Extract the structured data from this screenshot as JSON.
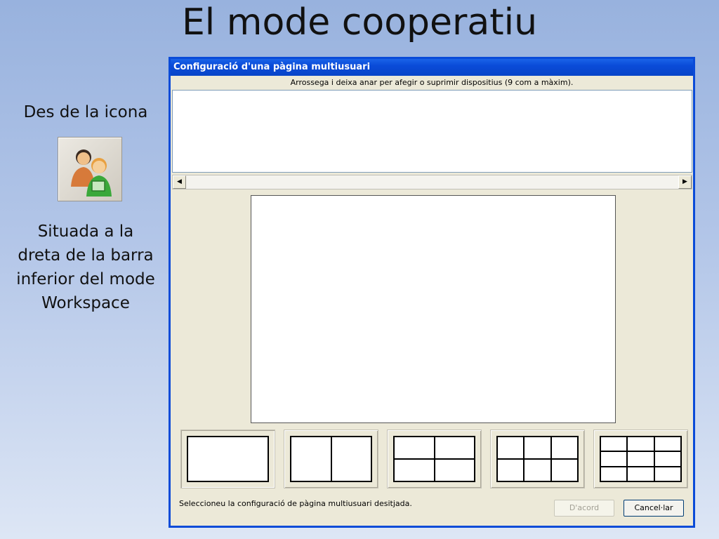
{
  "slide": {
    "title": "El mode cooperatiu",
    "caption_top": "Des de la icona",
    "caption_bottom": "Situada a la dreta de la barra inferior del mode Workspace"
  },
  "dialog": {
    "title": "Configuració d'una pàgina multiusuari",
    "instruction": "Arrossega i deixa anar per afegir o suprimir dispositius (9 com a màxim).",
    "status": "Seleccioneu la configuració de pàgina multiusuari desitjada.",
    "ok_label": "D'acord",
    "cancel_label": "Cancel·lar",
    "scroll_left": "◀",
    "scroll_right": "▶"
  },
  "icons": {
    "multiuser": "users-icon"
  }
}
